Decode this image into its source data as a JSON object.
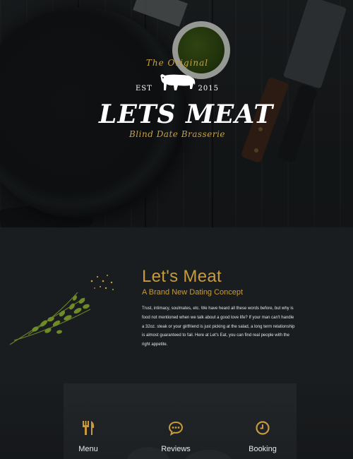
{
  "brand": {
    "tagline": "The Original",
    "est_label": "EST",
    "year": "2015",
    "name": "LETS MEAT",
    "subtitle": "Blind Date Brasserie"
  },
  "intro": {
    "title": "Let's Meat",
    "subtitle": "A Brand New Dating Concept",
    "body": "Trust, intimacy, soulmates, etc. We have heard all these words before, but why is food not mentioned when we talk about a good love life? If your man can't handle a 32oz. steak or your girlfriend is just picking at the salad, a long term relationship is almost guaranteed to fail. Here at Let's Eat, you can find real people with the right appetite."
  },
  "nav": [
    {
      "label": "Menu",
      "icon": "fork-knife-icon"
    },
    {
      "label": "Reviews",
      "icon": "speech-bubble-icon"
    },
    {
      "label": "Booking",
      "icon": "clock-icon"
    }
  ],
  "colors": {
    "accent": "#c79b3b",
    "background": "#191d20",
    "text": "#ffffff"
  }
}
